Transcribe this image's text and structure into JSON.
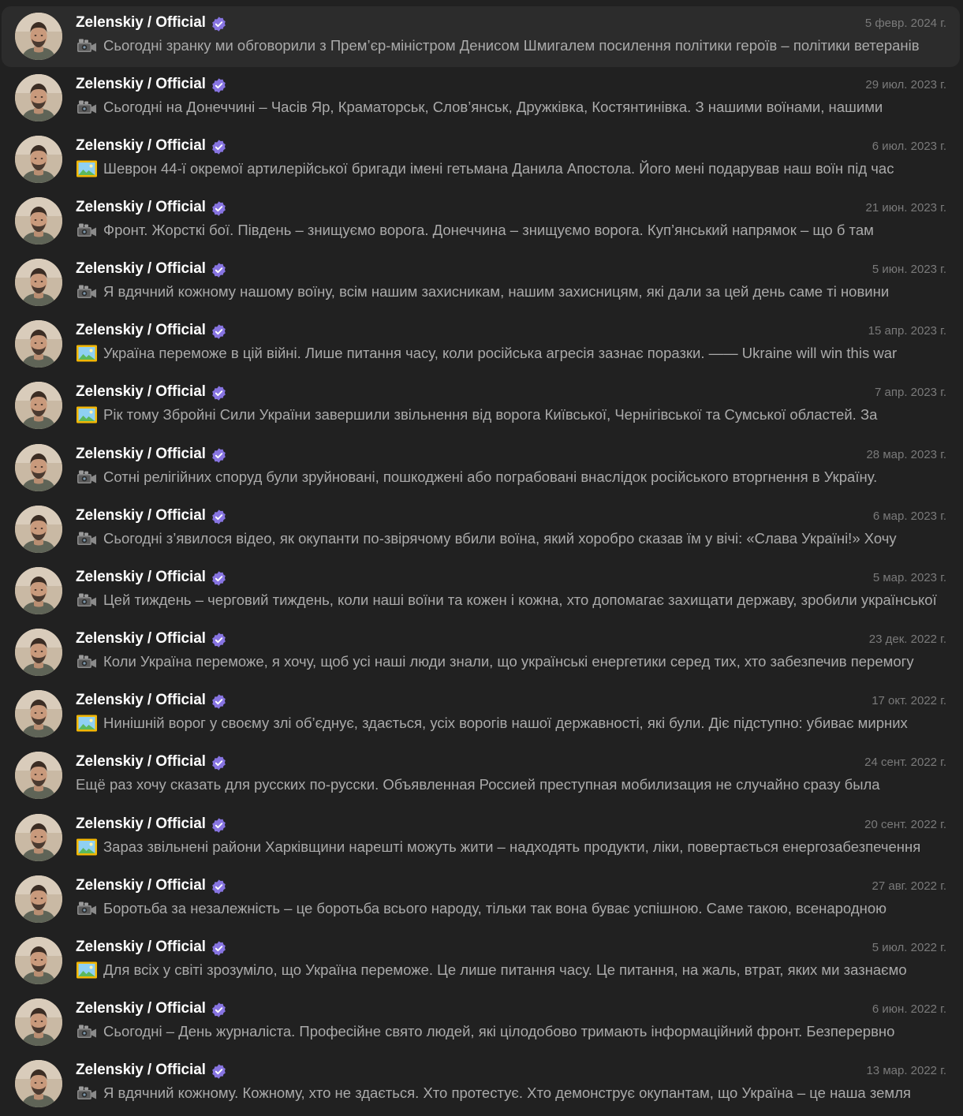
{
  "chats": [
    {
      "name": "Zelenskiy / Official",
      "verified": true,
      "date": "5 февр. 2024 г.",
      "media_icon": "video-camera-icon",
      "preview": "Сьогодні зранку ми обговорили з Прем’єр-міністром Денисом Шмигалем посилення політики героїв – політики ветеранів",
      "active": true
    },
    {
      "name": "Zelenskiy / Official",
      "verified": true,
      "date": "29 июл. 2023 г.",
      "media_icon": "video-camera-icon",
      "preview": "Сьогодні на Донеччині – Часів Яр, Краматорськ, Слов’янськ, Дружківка, Костянтинівка. З нашими воїнами, нашими"
    },
    {
      "name": "Zelenskiy / Official",
      "verified": true,
      "date": "6 июл. 2023 г.",
      "media_icon": "picture-icon",
      "preview": "Шеврон 44-ї окремої артилерійської бригади імені гетьмана Данила Апостола. Його мені подарував наш воїн під час"
    },
    {
      "name": "Zelenskiy / Official",
      "verified": true,
      "date": "21 июн. 2023 г.",
      "media_icon": "video-camera-icon",
      "preview": "Фронт. Жорсткі бої. Південь – знищуємо ворога. Донеччина – знищуємо ворога. Куп’янський напрямок – що б там"
    },
    {
      "name": "Zelenskiy / Official",
      "verified": true,
      "date": "5 июн. 2023 г.",
      "media_icon": "video-camera-icon",
      "preview": "Я вдячний кожному нашому воїну, всім нашим захисникам, нашим захисницям, які дали за цей день саме ті новини"
    },
    {
      "name": "Zelenskiy / Official",
      "verified": true,
      "date": "15 апр. 2023 г.",
      "media_icon": "picture-icon",
      "preview": "Україна переможе в цій війні. Лише питання часу, коли російська агресія зазнає поразки. —— Ukraine will win this war"
    },
    {
      "name": "Zelenskiy / Official",
      "verified": true,
      "date": "7 апр. 2023 г.",
      "media_icon": "picture-icon",
      "preview": "Рік тому Збройні Сили України завершили звільнення від ворога Київської, Чернігівської та Сумської областей. За"
    },
    {
      "name": "Zelenskiy / Official",
      "verified": true,
      "date": "28 мар. 2023 г.",
      "media_icon": "video-camera-icon",
      "preview": "Сотні релігійних споруд були зруйновані, пошкоджені або пограбовані внаслідок російського вторгнення в Україну."
    },
    {
      "name": "Zelenskiy / Official",
      "verified": true,
      "date": "6 мар. 2023 г.",
      "media_icon": "video-camera-icon",
      "preview": "Сьогодні з’явилося відео, як окупанти по-звірячому вбили воїна, який хоробро сказав їм у вічі: «Слава Україні!» Хочу"
    },
    {
      "name": "Zelenskiy / Official",
      "verified": true,
      "date": "5 мар. 2023 г.",
      "media_icon": "video-camera-icon",
      "preview": "Цей тиждень – черговий тиждень, коли наші воїни та кожен і кожна, хто допомагає захищати державу, зробили української"
    },
    {
      "name": "Zelenskiy / Official",
      "verified": true,
      "date": "23 дек. 2022 г.",
      "media_icon": "video-camera-icon",
      "preview": "Коли Україна переможе, я хочу, щоб усі наші люди знали, що українські енергетики серед тих, хто забезпечив перемогу"
    },
    {
      "name": "Zelenskiy / Official",
      "verified": true,
      "date": "17 окт. 2022 г.",
      "media_icon": "picture-icon",
      "preview": "Нинішній ворог у своєму злі об’єднує, здається, усіх ворогів нашої державності, які були. Діє підступно: убиває мирних"
    },
    {
      "name": "Zelenskiy / Official",
      "verified": true,
      "date": "24 сент. 2022 г.",
      "media_icon": "",
      "preview": "Ещё раз хочу сказать для русских по-русски. Объявленная Россией преступная мобилизация не случайно сразу была"
    },
    {
      "name": "Zelenskiy / Official",
      "verified": true,
      "date": "20 сент. 2022 г.",
      "media_icon": "picture-icon",
      "preview": "Зараз звільнені райони Харківщини нарешті можуть жити – надходять продукти, ліки, повертається енергозабезпечення"
    },
    {
      "name": "Zelenskiy / Official",
      "verified": true,
      "date": "27 авг. 2022 г.",
      "media_icon": "video-camera-icon",
      "preview": "Боротьба за незалежність – це боротьба всього народу, тільки так вона буває успішною. Саме такою, всенародною"
    },
    {
      "name": "Zelenskiy / Official",
      "verified": true,
      "date": "5 июл. 2022 г.",
      "media_icon": "picture-icon",
      "preview": "Для всіх у світі зрозуміло, що Україна переможе. Це лише питання часу. Це питання, на жаль, втрат, яких ми зазнаємо"
    },
    {
      "name": "Zelenskiy / Official",
      "verified": true,
      "date": "6 июн. 2022 г.",
      "media_icon": "video-camera-icon",
      "preview": "Сьогодні – День журналіста. Професійне свято людей, які цілодобово тримають інформаційний фронт. Безперервно"
    },
    {
      "name": "Zelenskiy / Official",
      "verified": true,
      "date": "13 мар. 2022 г.",
      "media_icon": "video-camera-icon",
      "preview": "Я вдячний кожному. Кожному, хто не здається. Хто протестує. Хто демонструє окупантам, що Україна – це наша земля"
    }
  ],
  "colors": {
    "background": "#212121",
    "active_row": "#2c2c2c",
    "name": "#ffffff",
    "preview": "#aaaaaa",
    "date": "#7a7a7a",
    "verified_badge": "#8774e1"
  }
}
